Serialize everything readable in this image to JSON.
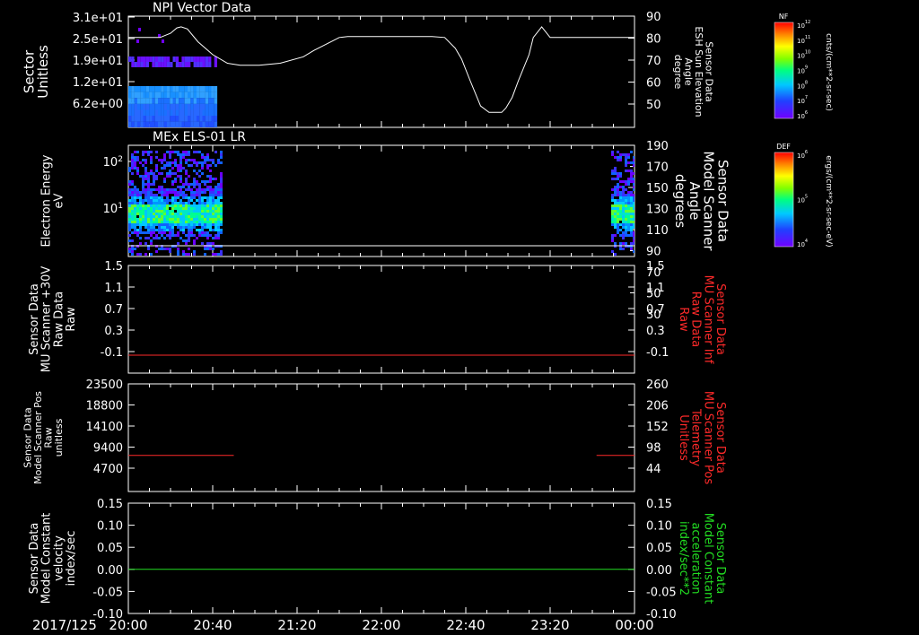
{
  "chart_data": [
    {
      "type": "heatmap",
      "title": "NPI Vector Data",
      "ylabel": [
        "Sector",
        "Unitless"
      ],
      "y_ticks": [
        "3.1e+01",
        "2.5e+01",
        "1.9e+01",
        "1.2e+01",
        "6.2e+00"
      ],
      "right_ylabel": [
        "Sensor Data",
        "ESH Sun Elevation",
        "Angle",
        "degree"
      ],
      "right_ylim": [
        38,
        90
      ],
      "right_ticks": [
        90,
        80,
        70,
        60,
        50
      ],
      "right_series": {
        "name": "ESH Sun Elevation Angle",
        "color": "#ffffff",
        "x": [
          0,
          7,
          15,
          20,
          23,
          25,
          28,
          33,
          40,
          47,
          53,
          62,
          72,
          83,
          88,
          92,
          97,
          100,
          104,
          107,
          113,
          118,
          124,
          136,
          144,
          150,
          155,
          158,
          162,
          167,
          171,
          175,
          177,
          179,
          182,
          185,
          190,
          192,
          196,
          200,
          210,
          240
        ],
        "y": [
          80,
          80,
          80,
          82,
          84.5,
          85,
          84,
          78,
          72,
          68,
          67,
          67,
          68,
          71,
          74,
          76,
          78.5,
          80,
          80.5,
          80.5,
          80.5,
          80.5,
          80.5,
          80.5,
          80.5,
          80,
          75,
          70,
          60,
          48,
          45,
          45,
          45,
          47,
          52,
          60,
          72,
          80,
          85,
          80,
          80,
          80
        ]
      },
      "colorbar": {
        "label": "NF",
        "units": "cnts/(cm**2-sr-sec)",
        "ticks": [
          "10^12",
          "10^11",
          "10^10",
          "10^9",
          "10^8",
          "10^7",
          "10^6"
        ]
      },
      "grid": false
    },
    {
      "type": "heatmap",
      "title": "MEx ELS-01 LR",
      "ylabel": [
        "Electron Energy",
        "eV"
      ],
      "y_ticks": [
        "10^2",
        "10^1"
      ],
      "right_ylabel": [
        "Sensor Data",
        "Model Scanner",
        "Angle",
        "degrees"
      ],
      "right_ylim": [
        10,
        190
      ],
      "right_ticks": [
        190,
        150,
        110,
        70,
        30
      ],
      "right_extra_ticks": [
        170,
        130,
        90,
        50
      ],
      "colorbar": {
        "label": "DEF",
        "units": "ergs/(cm**2-sr-sec-eV)",
        "ticks": [
          "10^6",
          "10^5",
          "10^4"
        ]
      },
      "grid": false
    },
    {
      "type": "line",
      "ylabel": [
        "Sensor Data",
        "MU Scanner +30V",
        "Raw Data",
        "Raw"
      ],
      "ylim": [
        -0.3,
        1.5
      ],
      "y_ticks": [
        "1.5",
        "1.1",
        "0.7",
        "0.3",
        "-0.1"
      ],
      "right_ylabel": [
        "Sensor Data",
        "MU Scanner Inf",
        "Raw Data",
        "Raw"
      ],
      "right_ticks": [
        "1.5",
        "1.1",
        "0.7",
        "0.3",
        "-0.1"
      ],
      "series": [
        {
          "color": "#ff2a2a",
          "x": [
            0,
            240
          ],
          "y": [
            0,
            0
          ]
        }
      ]
    },
    {
      "type": "line",
      "ylabel": [
        "Sensor Data",
        "Model Scanner Pos",
        "Raw",
        "unitless"
      ],
      "ylim": [
        0,
        23500
      ],
      "y_ticks": [
        "23500",
        "18800",
        "14100",
        "9400",
        "4700"
      ],
      "right_ylabel": [
        "Sensor Data",
        "MU Scanner Pos",
        "Telemetry",
        "Unitless"
      ],
      "right_ticks": [
        "260",
        "206",
        "152",
        "98",
        "44"
      ],
      "series": [
        {
          "color": "#ff2a2a",
          "x": [
            0,
            50
          ],
          "y": [
            7900,
            7900
          ]
        },
        {
          "color": "#ff2a2a",
          "x": [
            222,
            240
          ],
          "y": [
            7900,
            7900
          ]
        }
      ]
    },
    {
      "type": "line",
      "ylabel": [
        "Sensor Data",
        "Model Constant",
        "velocity",
        "index/sec"
      ],
      "ylim": [
        -0.1,
        0.15
      ],
      "y_ticks": [
        "0.15",
        "0.10",
        "0.05",
        "0.00",
        "-0.05",
        "-0.10"
      ],
      "right_ylabel": [
        "Sensor Data",
        "Model Constant",
        "acceleration",
        "index/sec**2"
      ],
      "right_ticks": [
        "0.15",
        "0.10",
        "0.05",
        "0.00",
        "-0.05",
        "-0.10"
      ],
      "series": [
        {
          "color": "#22dd22",
          "x": [
            0,
            240
          ],
          "y": [
            0,
            0
          ]
        }
      ]
    }
  ],
  "x_axis": {
    "date": "2017/125",
    "tick_labels": [
      "20:00",
      "20:40",
      "21:20",
      "22:00",
      "22:40",
      "23:20",
      "00:00"
    ],
    "range_minutes": [
      0,
      240
    ]
  },
  "colors": {
    "background": "#000000",
    "axes": "#ffffff",
    "right_label_red": "#ff2a2a",
    "right_label_green": "#22dd22"
  }
}
